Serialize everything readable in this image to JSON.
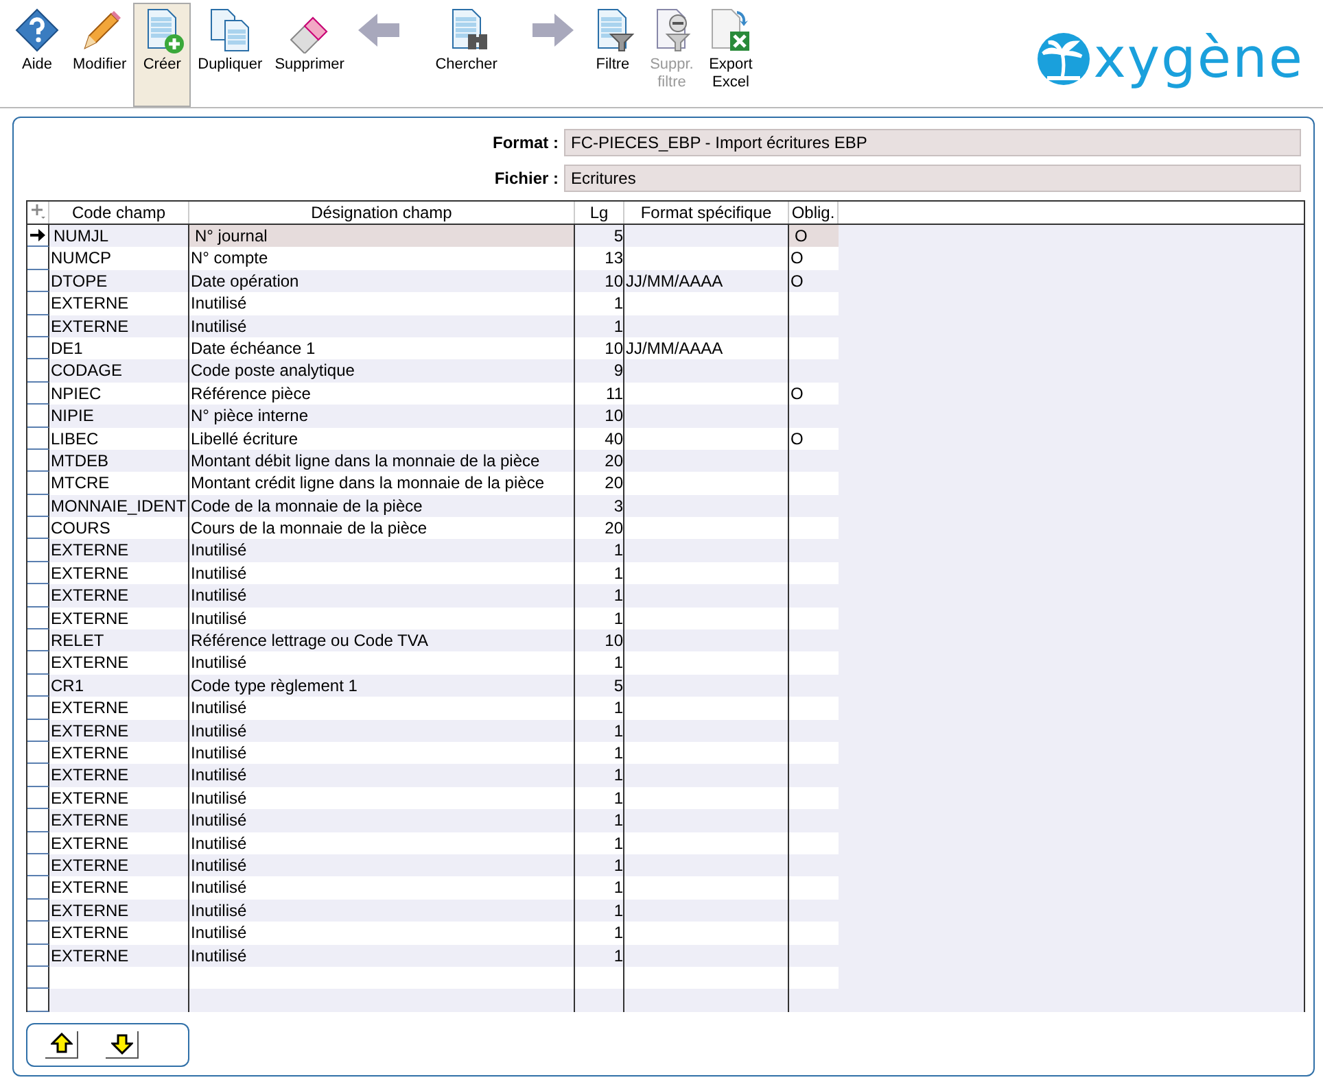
{
  "toolbar": [
    {
      "kind": "help",
      "label": "Aide",
      "selected": false,
      "disabled": false
    },
    {
      "kind": "edit",
      "label": "Modifier",
      "selected": false,
      "disabled": false
    },
    {
      "kind": "create",
      "label": "Créer",
      "selected": true,
      "disabled": false
    },
    {
      "kind": "duplicate",
      "label": "Dupliquer",
      "selected": false,
      "disabled": false
    },
    {
      "kind": "delete",
      "label": "Supprimer",
      "selected": false,
      "disabled": false
    },
    {
      "kind": "prev",
      "selected": false,
      "disabled": true
    },
    {
      "kind": "search",
      "label": "Chercher",
      "selected": false,
      "disabled": false
    },
    {
      "kind": "next",
      "selected": false,
      "disabled": true
    },
    {
      "kind": "filter",
      "label": "Filtre",
      "selected": false,
      "disabled": false
    },
    {
      "kind": "unfilter",
      "label": "Suppr. filtre",
      "selected": false,
      "disabled": true
    },
    {
      "kind": "export",
      "label": "Export Excel",
      "selected": false,
      "disabled": false
    }
  ],
  "logo": {
    "text": "xygène"
  },
  "form": {
    "fields": [
      {
        "label": "Format :",
        "value": "FC-PIECES_EBP - Import écritures EBP"
      },
      {
        "label": "Fichier :",
        "value": "Ecritures"
      }
    ]
  },
  "table": {
    "columns": [
      "Code champ",
      "Désignation champ",
      "Lg",
      "Format spécifique",
      "Oblig."
    ],
    "rows": [
      {
        "code": "NUMJL",
        "designation": "N° journal",
        "lg": "5",
        "format": "",
        "oblig": "O",
        "selected": true
      },
      {
        "code": "NUMCP",
        "designation": "N° compte",
        "lg": "13",
        "format": "",
        "oblig": "O",
        "selected": false
      },
      {
        "code": "DTOPE",
        "designation": "Date opération",
        "lg": "10",
        "format": "JJ/MM/AAAA",
        "oblig": "O",
        "selected": false
      },
      {
        "code": "EXTERNE",
        "designation": "Inutilisé",
        "lg": "1",
        "format": "",
        "oblig": "",
        "selected": false
      },
      {
        "code": "EXTERNE",
        "designation": "Inutilisé",
        "lg": "1",
        "format": "",
        "oblig": "",
        "selected": false
      },
      {
        "code": "DE1",
        "designation": "Date échéance 1",
        "lg": "10",
        "format": "JJ/MM/AAAA",
        "oblig": "",
        "selected": false
      },
      {
        "code": "CODAGE",
        "designation": "Code poste analytique",
        "lg": "9",
        "format": "",
        "oblig": "",
        "selected": false
      },
      {
        "code": "NPIEC",
        "designation": "Référence pièce",
        "lg": "11",
        "format": "",
        "oblig": "O",
        "selected": false
      },
      {
        "code": "NIPIE",
        "designation": "N° pièce interne",
        "lg": "10",
        "format": "",
        "oblig": "",
        "selected": false
      },
      {
        "code": "LIBEC",
        "designation": "Libellé écriture",
        "lg": "40",
        "format": "",
        "oblig": "O",
        "selected": false
      },
      {
        "code": "MTDEB",
        "designation": "Montant débit ligne dans la monnaie de la pièce",
        "lg": "20",
        "format": "",
        "oblig": "",
        "selected": false
      },
      {
        "code": "MTCRE",
        "designation": "Montant crédit ligne dans la monnaie de la pièce",
        "lg": "20",
        "format": "",
        "oblig": "",
        "selected": false
      },
      {
        "code": "MONNAIE_IDENT",
        "designation": "Code de la monnaie de la pièce",
        "lg": "3",
        "format": "",
        "oblig": "",
        "selected": false
      },
      {
        "code": "COURS",
        "designation": "Cours de la monnaie de la pièce",
        "lg": "20",
        "format": "",
        "oblig": "",
        "selected": false
      },
      {
        "code": "EXTERNE",
        "designation": "Inutilisé",
        "lg": "1",
        "format": "",
        "oblig": "",
        "selected": false
      },
      {
        "code": "EXTERNE",
        "designation": "Inutilisé",
        "lg": "1",
        "format": "",
        "oblig": "",
        "selected": false
      },
      {
        "code": "EXTERNE",
        "designation": "Inutilisé",
        "lg": "1",
        "format": "",
        "oblig": "",
        "selected": false
      },
      {
        "code": "EXTERNE",
        "designation": "Inutilisé",
        "lg": "1",
        "format": "",
        "oblig": "",
        "selected": false
      },
      {
        "code": "RELET",
        "designation": "Référence lettrage ou Code TVA",
        "lg": "10",
        "format": "",
        "oblig": "",
        "selected": false
      },
      {
        "code": "EXTERNE",
        "designation": "Inutilisé",
        "lg": "1",
        "format": "",
        "oblig": "",
        "selected": false
      },
      {
        "code": "CR1",
        "designation": "Code type règlement 1",
        "lg": "5",
        "format": "",
        "oblig": "",
        "selected": false
      },
      {
        "code": "EXTERNE",
        "designation": "Inutilisé",
        "lg": "1",
        "format": "",
        "oblig": "",
        "selected": false
      },
      {
        "code": "EXTERNE",
        "designation": "Inutilisé",
        "lg": "1",
        "format": "",
        "oblig": "",
        "selected": false
      },
      {
        "code": "EXTERNE",
        "designation": "Inutilisé",
        "lg": "1",
        "format": "",
        "oblig": "",
        "selected": false
      },
      {
        "code": "EXTERNE",
        "designation": "Inutilisé",
        "lg": "1",
        "format": "",
        "oblig": "",
        "selected": false
      },
      {
        "code": "EXTERNE",
        "designation": "Inutilisé",
        "lg": "1",
        "format": "",
        "oblig": "",
        "selected": false
      },
      {
        "code": "EXTERNE",
        "designation": "Inutilisé",
        "lg": "1",
        "format": "",
        "oblig": "",
        "selected": false
      },
      {
        "code": "EXTERNE",
        "designation": "Inutilisé",
        "lg": "1",
        "format": "",
        "oblig": "",
        "selected": false
      },
      {
        "code": "EXTERNE",
        "designation": "Inutilisé",
        "lg": "1",
        "format": "",
        "oblig": "",
        "selected": false
      },
      {
        "code": "EXTERNE",
        "designation": "Inutilisé",
        "lg": "1",
        "format": "",
        "oblig": "",
        "selected": false
      },
      {
        "code": "EXTERNE",
        "designation": "Inutilisé",
        "lg": "1",
        "format": "",
        "oblig": "",
        "selected": false
      },
      {
        "code": "EXTERNE",
        "designation": "Inutilisé",
        "lg": "1",
        "format": "",
        "oblig": "",
        "selected": false
      },
      {
        "code": "EXTERNE",
        "designation": "Inutilisé",
        "lg": "1",
        "format": "",
        "oblig": "",
        "selected": false
      }
    ]
  }
}
